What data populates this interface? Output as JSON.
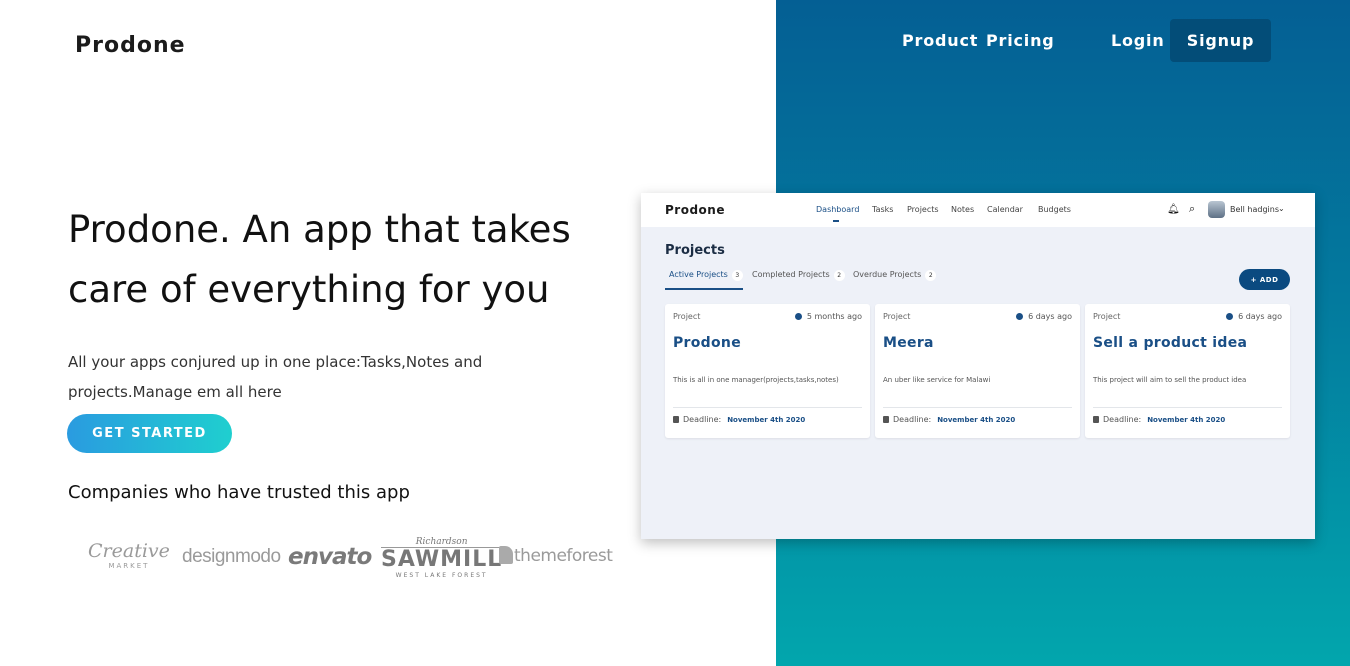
{
  "brand": "Prodone",
  "nav": {
    "product": "Product",
    "pricing": "Pricing",
    "login": "Login",
    "signup": "Signup"
  },
  "hero": {
    "title": "Prodone. An app that takes care of everything for you",
    "description": "All your apps conjured up in one place:Tasks,Notes and projects.Manage em all here",
    "cta": "GET STARTED",
    "companies_title": "Companies who have trusted this app"
  },
  "logos": {
    "creative_market": [
      "Creative",
      "MARKET"
    ],
    "designmodo": "designmodo",
    "envato": "envato",
    "sawmill": [
      "Richardson",
      "SAWMILL",
      "WEST LAKE FOREST"
    ],
    "themeforest": "themeforest"
  },
  "mockup": {
    "brand": "Prodone",
    "nav": [
      "Dashboard",
      "Tasks",
      "Projects",
      "Notes",
      "Calendar",
      "Budgets"
    ],
    "user": "Bell hadgins",
    "title": "Projects",
    "tabs": [
      {
        "label": "Active Projects",
        "count": "3"
      },
      {
        "label": "Completed Projects",
        "count": "2"
      },
      {
        "label": "Overdue Projects",
        "count": "2"
      }
    ],
    "add_label": "+ ADD",
    "cards": [
      {
        "label": "Project",
        "time": "5 months ago",
        "name": "Prodone",
        "desc": "This is all in one manager(projects,tasks,notes)",
        "deadline_label": "Deadline:",
        "deadline": "November 4th 2020"
      },
      {
        "label": "Project",
        "time": "6 days ago",
        "name": "Meera",
        "desc": "An uber like service for Malawi",
        "deadline_label": "Deadline:",
        "deadline": "November 4th 2020"
      },
      {
        "label": "Project",
        "time": "6 days ago",
        "name": "Sell a product idea",
        "desc": "This project will aim to sell the product idea",
        "deadline_label": "Deadline:",
        "deadline": "November 4th 2020"
      }
    ]
  },
  "colors": {
    "gradient_top": "#045f94",
    "gradient_bottom": "#02a6ad",
    "signup_bg": "#034d78",
    "accent_blue": "#1a4f86"
  }
}
